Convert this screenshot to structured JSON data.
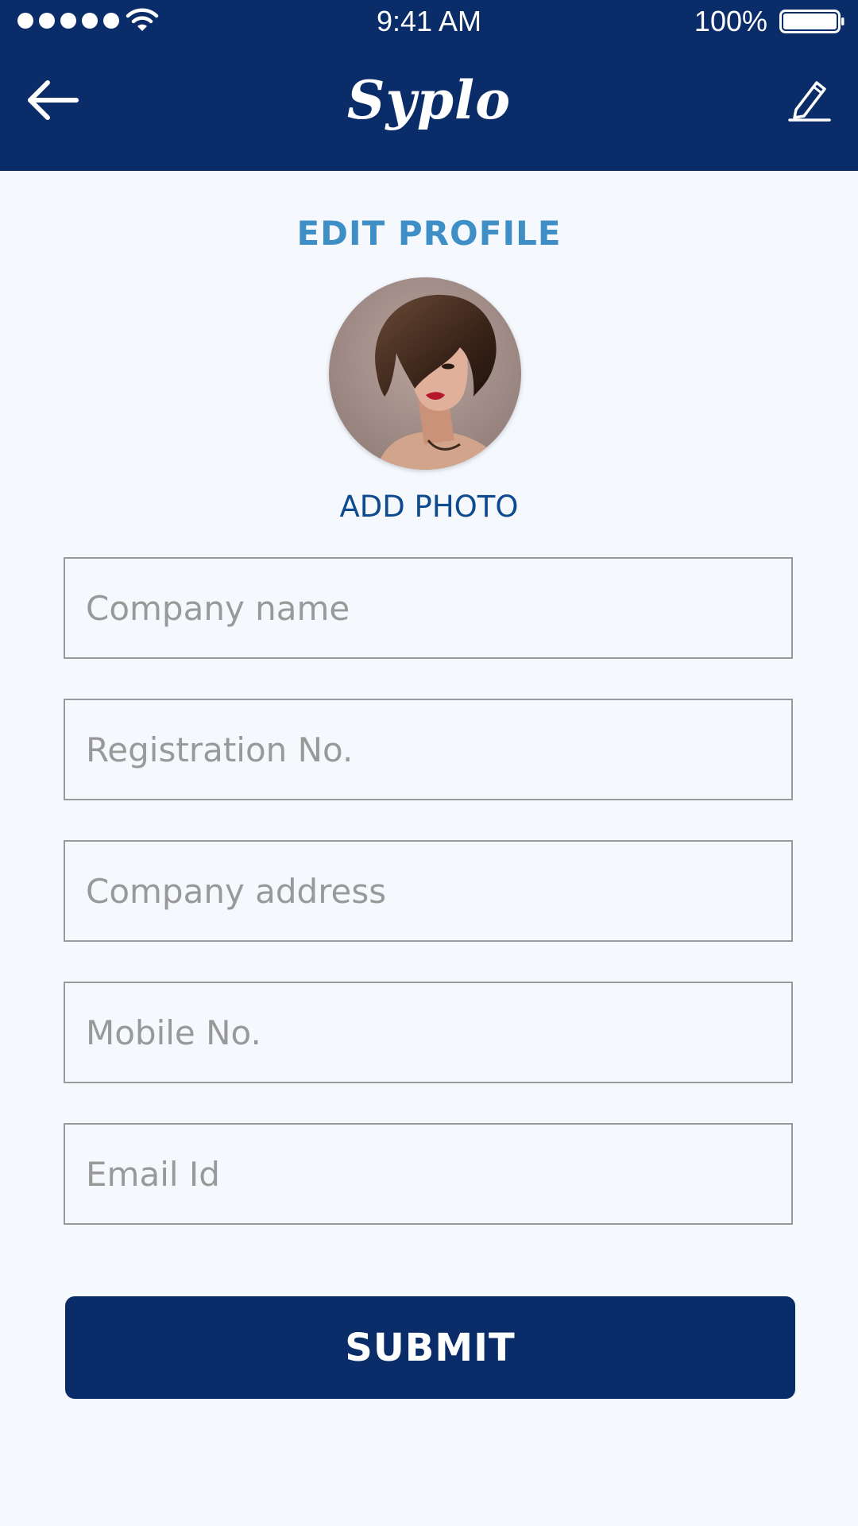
{
  "status_bar": {
    "time": "9:41 AM",
    "battery_percent": "100%",
    "signal_dots": 5,
    "icons": [
      "signal-dots-icon",
      "wifi-icon",
      "battery-icon"
    ]
  },
  "header": {
    "app_title": "Syplo",
    "back_icon": "arrow-left-icon",
    "edit_icon": "pencil-icon"
  },
  "profile": {
    "section_title": "EDIT PROFILE",
    "avatar_icon": "profile-photo",
    "add_photo_label": "ADD PHOTO"
  },
  "form": {
    "fields": [
      {
        "placeholder": "Company name",
        "value": ""
      },
      {
        "placeholder": "Registration No.",
        "value": ""
      },
      {
        "placeholder": "Company address",
        "value": ""
      },
      {
        "placeholder": "Mobile No.",
        "value": ""
      },
      {
        "placeholder": "Email Id",
        "value": ""
      }
    ],
    "submit_label": "SUBMIT"
  },
  "colors": {
    "header_bg": "#0a2d69",
    "page_bg": "#f5f8fd",
    "section_title": "#3e8fc6",
    "add_photo": "#0e4a90",
    "field_border": "#9a9a9a",
    "placeholder": "#999999"
  }
}
